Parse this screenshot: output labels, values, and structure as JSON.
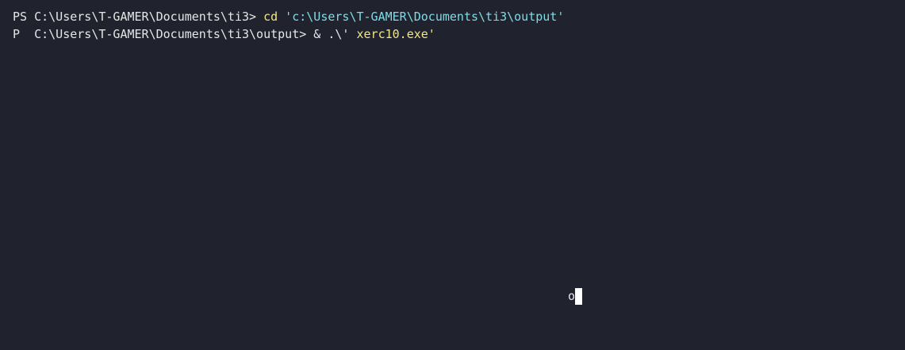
{
  "terminal": {
    "background": "#20232e",
    "lines": [
      {
        "prompt": "PS C:\\Users\\T-GAMER\\Documents\\ti3> ",
        "command": "cd",
        "space": " ",
        "argument": "'c:\\Users\\T-GAMER\\Documents\\ti3\\output'"
      },
      {
        "prompt": "P  C:\\Users\\T-GAMER\\Documents\\ti3\\output> ",
        "operator": "& ",
        "argument_a": ".\\' ",
        "argument_b": "xerc10.exe'"
      }
    ],
    "output_char": "o"
  },
  "colors": {
    "command": "#f0e68c",
    "string": "#7fdbe8",
    "text": "#e6e6e6",
    "cursor": "#ffffff"
  }
}
